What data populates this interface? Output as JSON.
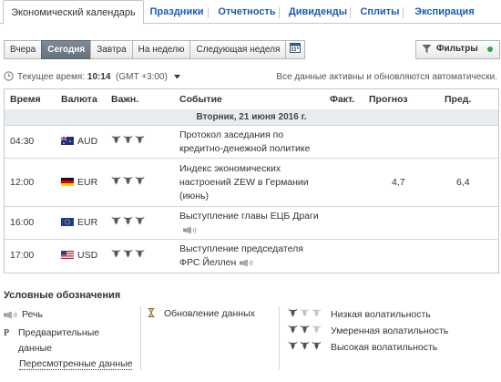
{
  "tabs": [
    {
      "label": "Экономический календарь",
      "active": true
    },
    {
      "label": "Праздники"
    },
    {
      "label": "Отчетность"
    },
    {
      "label": "Дивиденды"
    },
    {
      "label": "Сплиты"
    },
    {
      "label": "Экспирация"
    }
  ],
  "period_buttons": [
    "Вчера",
    "Сегодня",
    "Завтра",
    "На неделю",
    "Следующая неделя"
  ],
  "active_period": "Сегодня",
  "filters_label": "Фильтры",
  "timebar": {
    "label": "Текущее время:",
    "time": "10:14",
    "tz": "(GMT +3:00)",
    "auto_note": "Все данные активны и обновляются автоматически."
  },
  "columns": {
    "time": "Время",
    "currency": "Валюта",
    "importance": "Важн.",
    "event": "Событие",
    "actual": "Факт.",
    "forecast": "Прогноз",
    "previous": "Пред."
  },
  "date_row": "Вторник, 21 июня 2016 г.",
  "events": [
    {
      "time": "04:30",
      "flag": "AU",
      "currency": "AUD",
      "importance": 3,
      "event_line1": "Протокол заседания по",
      "event_line2": "кредитно-денежной политике",
      "actual": "",
      "forecast": "",
      "previous": "",
      "speech": false
    },
    {
      "time": "12:00",
      "flag": "DE",
      "currency": "EUR",
      "importance": 3,
      "event_line1": "Индекс экономических",
      "event_line2": "настроений ZEW в Германии",
      "event_line3": "(июнь)",
      "actual": "",
      "forecast": "4,7",
      "previous": "6,4",
      "speech": false
    },
    {
      "time": "16:00",
      "flag": "EU",
      "currency": "EUR",
      "importance": 3,
      "event_line1": "Выступление главы ЕЦБ Драги",
      "actual": "",
      "forecast": "",
      "previous": "",
      "speech": true
    },
    {
      "time": "17:00",
      "flag": "US",
      "currency": "USD",
      "importance": 3,
      "event_line1": "Выступление председателя",
      "event_line2": "ФРС Йеллен",
      "actual": "",
      "forecast": "",
      "previous": "",
      "speech": true
    }
  ],
  "legend": {
    "title": "Условные обозначения",
    "speech": "Речь",
    "preliminary_letter": "P",
    "preliminary_line1": "Предварительные",
    "preliminary_line2": "данные",
    "revised": "Пересмотренные данные",
    "update": "Обновление данных",
    "low": "Низкая волатильность",
    "medium": "Умеренная волатильность",
    "high": "Высокая волатильность"
  },
  "colors": {
    "link": "#1a5bb5",
    "active_btn": "#6f7a85",
    "filter_dot": "#2da44e",
    "date_row_bg": "#e9ecef"
  }
}
